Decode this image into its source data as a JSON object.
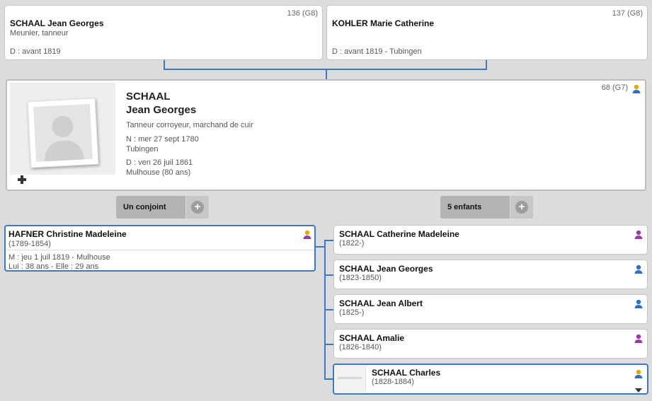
{
  "father": {
    "sosa": "136 (G8)",
    "name": "SCHAAL Jean Georges",
    "occupation": "Meunier, tanneur",
    "death": "D : avant 1819"
  },
  "mother": {
    "sosa": "137 (G8)",
    "name": "KOHLER Marie Catherine",
    "death": "D : avant 1819 - Tubingen"
  },
  "main": {
    "sosa": "68 (G7)",
    "surname": "SCHAAL",
    "given": "Jean Georges",
    "occupation": "Tanneur corroyeur, marchand de cuir",
    "birth_date": "N : mer 27 sept 1780",
    "birth_place": "Tubingen",
    "death_date": "D : ven 26 juil 1861",
    "death_place": "Mulhouse (80 ans)"
  },
  "spouse_pill": {
    "label": "Un conjoint",
    "plus": "+"
  },
  "children_pill": {
    "label": "5 enfants",
    "plus": "+"
  },
  "spouse": {
    "name": "HAFNER Christine Madeleine",
    "years": "(1789-1854)",
    "marriage": "M : jeu 1 juil 1819 - Mulhouse",
    "ages": "Lui : 38 ans - Elle : 29 ans"
  },
  "children": [
    {
      "name": "SCHAAL Catherine Madeleine",
      "years": "(1822-)",
      "sex": "female"
    },
    {
      "name": "SCHAAL Jean Georges",
      "years": "(1823-1850)",
      "sex": "male"
    },
    {
      "name": "SCHAAL Jean Albert",
      "years": "(1825-)",
      "sex": "male"
    },
    {
      "name": "SCHAAL Amalie",
      "years": "(1826-1840)",
      "sex": "female"
    },
    {
      "name": "SCHAAL Charles",
      "years": "(1828-1884)",
      "sex": "direct-line"
    }
  ],
  "colors": {
    "link_line": "#3a78c8",
    "male": "#2f6fc4",
    "female": "#9b3aa8",
    "direct_line": "#e6a800"
  },
  "icons": {
    "add_photo": "plus-icon",
    "person": "person-icon",
    "expand": "chevron-down-icon"
  }
}
